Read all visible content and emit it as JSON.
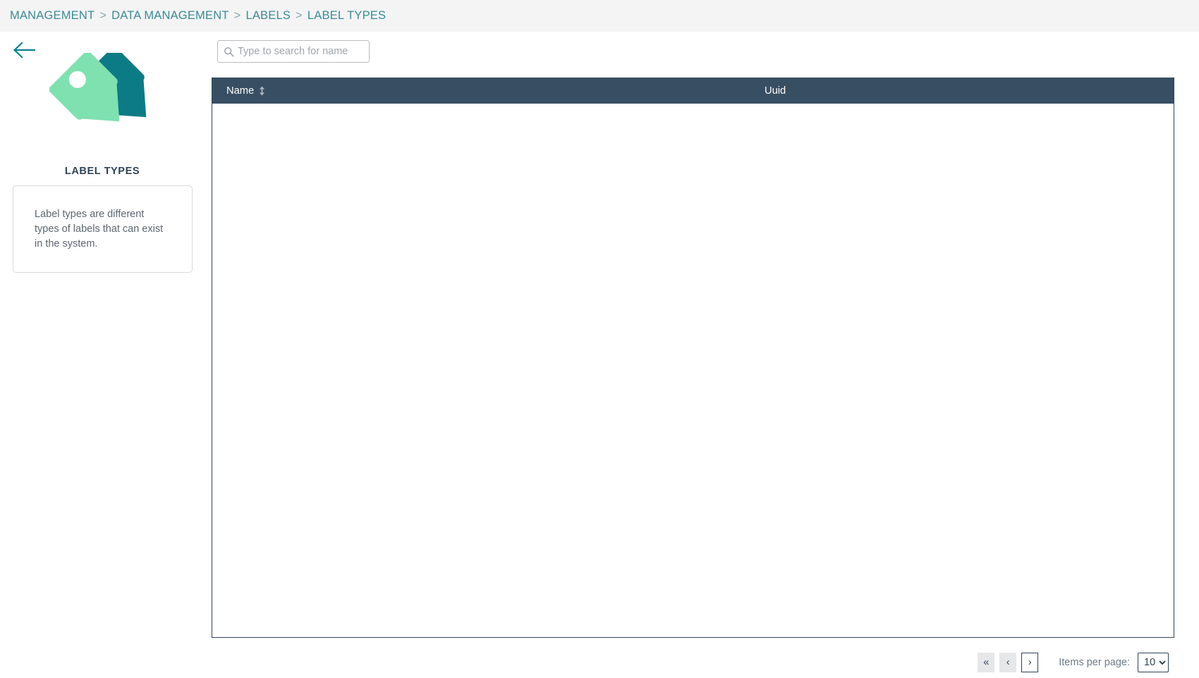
{
  "breadcrumb": {
    "items": [
      {
        "label": "MANAGEMENT"
      },
      {
        "label": "DATA MANAGEMENT"
      },
      {
        "label": "LABELS"
      },
      {
        "label": "LABEL TYPES"
      }
    ],
    "separator": ">"
  },
  "left_panel": {
    "back_icon": "arrow-left-icon",
    "illustration_icon": "tag-labels-icon",
    "title": "LABEL TYPES",
    "description": "Label types are different types of labels that can exist in the system."
  },
  "search": {
    "icon": "search-icon",
    "placeholder": "Type to search for name",
    "value": ""
  },
  "table": {
    "columns": [
      {
        "label": "Name",
        "sortable": true,
        "sort_icon": "sort-updown-icon"
      },
      {
        "label": "Uuid",
        "sortable": false
      }
    ],
    "rows": []
  },
  "paginator": {
    "first_page_label": "«",
    "prev_page_label": "‹",
    "next_page_label": "›",
    "items_per_page_label": "Items per page:",
    "items_per_page_value": "10",
    "items_per_page_options": [
      "10"
    ]
  },
  "colors": {
    "breadcrumb_bg": "#f4f4f5",
    "breadcrumb_text": "#3a8a94",
    "accent_teal": "#0a7f8c",
    "table_header_bg": "#384e63",
    "tag_front": "#7fe0b0",
    "tag_back": "#0d7b85",
    "title_text": "#2f4355"
  }
}
